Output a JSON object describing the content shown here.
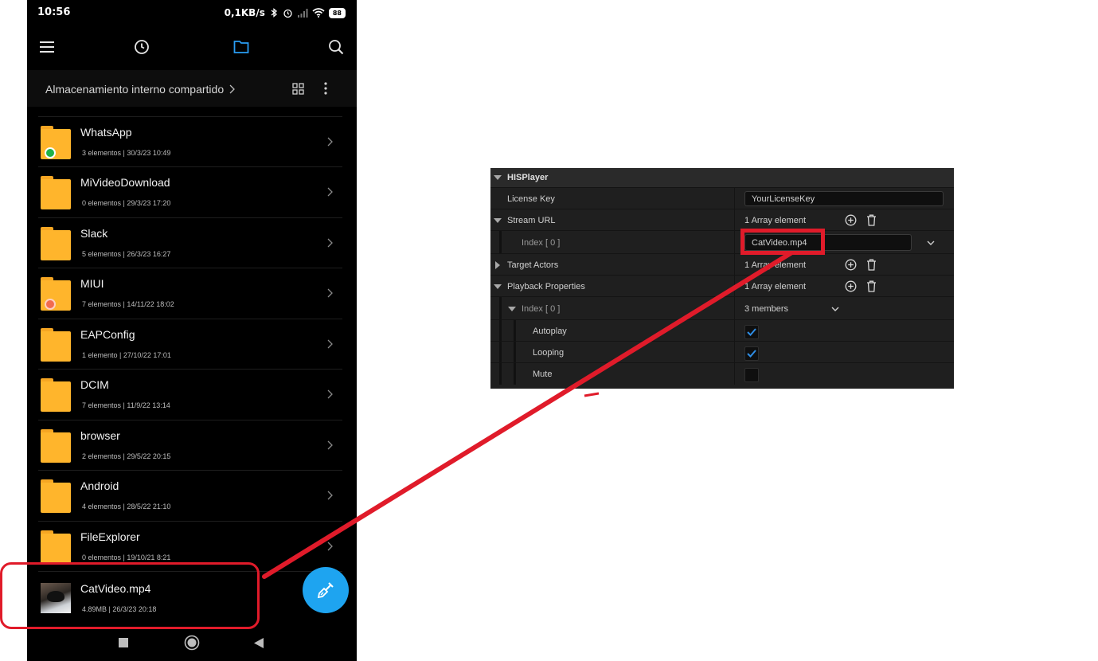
{
  "phone": {
    "status": {
      "time": "10:56",
      "net_speed": "0,1KB/s",
      "battery": "88"
    },
    "breadcrumb": "Almacenamiento interno compartido",
    "files": [
      {
        "name": "WhatsApp",
        "meta": "3 elementos  |  30/3/23 10:49",
        "badge": "whatsapp"
      },
      {
        "name": "MiVideoDownload",
        "meta": "0 elementos  |  29/3/23 17:20"
      },
      {
        "name": "Slack",
        "meta": "5 elementos  |  26/3/23 16:27"
      },
      {
        "name": "MIUI",
        "meta": "7 elementos  |  14/11/22 18:02",
        "badge": "miui"
      },
      {
        "name": "EAPConfig",
        "meta": "1 elemento  |  27/10/22 17:01"
      },
      {
        "name": "DCIM",
        "meta": "7 elementos  |  11/9/22 13:14"
      },
      {
        "name": "browser",
        "meta": "2 elementos  |  29/5/22 20:15"
      },
      {
        "name": "Android",
        "meta": "4 elementos  |  28/5/22 21:10"
      },
      {
        "name": "FileExplorer",
        "meta": "0 elementos  |  19/10/21 8:21"
      },
      {
        "name": "CatVideo.mp4",
        "meta": "4.89MB  |  26/3/23 20:18",
        "type": "video"
      }
    ],
    "colors": {
      "folder": "#ffb52c",
      "fab": "#1ea4f0",
      "whatsapp_badge": "#1fb24a",
      "miui_badge": "#f26b4f"
    }
  },
  "panel": {
    "section_title": "HISPlayer",
    "license_key": {
      "label": "License Key",
      "value": "YourLicenseKey"
    },
    "stream_url": {
      "label": "Stream URL",
      "summary": "1 Array element",
      "index_label": "Index [ 0 ]",
      "index_value": "CatVideo.mp4"
    },
    "target_actors": {
      "label": "Target Actors",
      "summary": "1 Array element"
    },
    "playback_properties": {
      "label": "Playback Properties",
      "summary": "1 Array element",
      "index_label": "Index [ 0 ]",
      "members": "3 members"
    },
    "autoplay": {
      "label": "Autoplay",
      "checked": true
    },
    "looping": {
      "label": "Looping",
      "checked": true
    },
    "mute": {
      "label": "Mute",
      "checked": false
    }
  },
  "annotation_color": "#e01b2a"
}
